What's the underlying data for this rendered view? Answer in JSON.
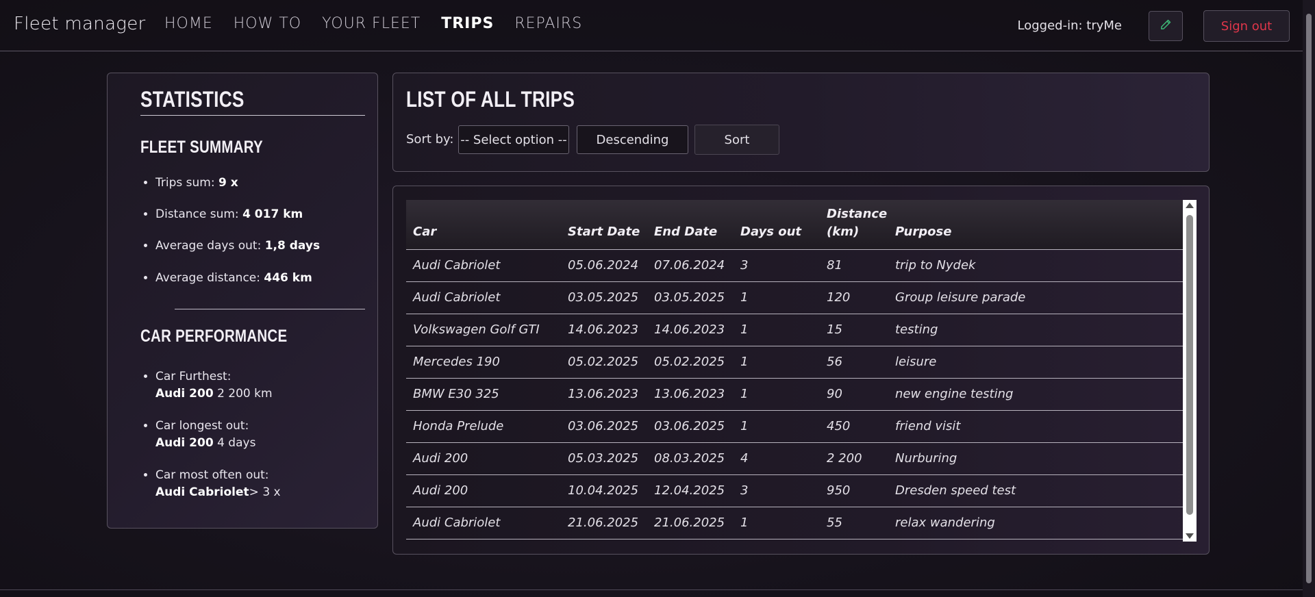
{
  "nav": {
    "brand": "Fleet manager",
    "links": [
      "HOME",
      "HOW TO",
      "YOUR FLEET",
      "TRIPS",
      "REPAIRS"
    ],
    "active": "TRIPS",
    "logged_in": "Logged-in: tryMe",
    "edit_icon": "pencil-icon",
    "sign_out": "Sign out",
    "colors": {
      "sign_out": "#e0364a",
      "edit_icon": "#3ec07a"
    }
  },
  "stats": {
    "title": "STATISTICS",
    "fleet_summary": {
      "heading": "FLEET SUMMARY",
      "items": [
        {
          "label": "Trips sum: ",
          "value": "9 x"
        },
        {
          "label": "Distance sum: ",
          "value": "4 017 km"
        },
        {
          "label": "Average days out: ",
          "value": "1,8 days"
        },
        {
          "label": "Average distance: ",
          "value": "446 km"
        }
      ]
    },
    "car_performance": {
      "heading": "CAR PERFORMANCE",
      "items": [
        {
          "label": "Car Furthest:",
          "car": "Audi 200",
          "value": " 2 200 km"
        },
        {
          "label": "Car longest out:",
          "car": "Audi 200",
          "value": " 4 days"
        },
        {
          "label": "Car most often out:",
          "car": "Audi Cabriolet",
          "value": "> 3 x"
        }
      ]
    }
  },
  "trips": {
    "title": "LIST OF ALL TRIPS",
    "sort_label": "Sort by:",
    "select_value": "-- Select option --",
    "order_button": "Descending",
    "sort_button": "Sort",
    "columns": [
      "Car",
      "Start Date",
      "End Date",
      "Days out",
      "Distance (km)",
      "Purpose"
    ],
    "rows": [
      [
        "Audi Cabriolet",
        "05.06.2024",
        "07.06.2024",
        "3",
        "81",
        "trip to Nydek"
      ],
      [
        "Audi Cabriolet",
        "03.05.2025",
        "03.05.2025",
        "1",
        "120",
        "Group leisure parade"
      ],
      [
        "Volkswagen Golf GTI",
        "14.06.2023",
        "14.06.2023",
        "1",
        "15",
        "testing"
      ],
      [
        "Mercedes 190",
        "05.02.2025",
        "05.02.2025",
        "1",
        "56",
        "leisure"
      ],
      [
        "BMW E30 325",
        "13.06.2023",
        "13.06.2023",
        "1",
        "90",
        "new engine testing"
      ],
      [
        "Honda Prelude",
        "03.06.2025",
        "03.06.2025",
        "1",
        "450",
        "friend visit"
      ],
      [
        "Audi 200",
        "05.03.2025",
        "08.03.2025",
        "4",
        "2 200",
        "Nurburing"
      ],
      [
        "Audi 200",
        "10.04.2025",
        "12.04.2025",
        "3",
        "950",
        "Dresden speed test"
      ],
      [
        "Audi Cabriolet",
        "21.06.2025",
        "21.06.2025",
        "1",
        "55",
        "relax wandering"
      ]
    ]
  }
}
